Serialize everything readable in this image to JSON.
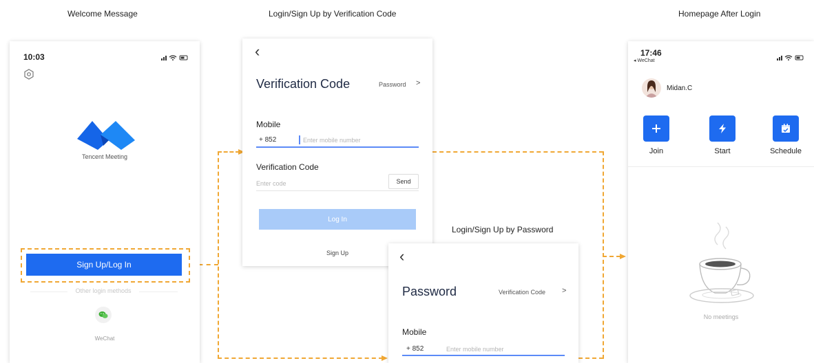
{
  "captions": {
    "welcome": "Welcome Message",
    "verify": "Login/Sign Up by Verification Code",
    "password": "Login/Sign Up by Password",
    "home": "Homepage After Login"
  },
  "welcome": {
    "time": "10:03",
    "app_name": "Tencent Meeting",
    "signup_button": "Sign Up/Log In",
    "other_methods": "Other login methods",
    "wechat_label": "WeChat"
  },
  "verify": {
    "back": "‹",
    "title": "Verification Code",
    "switch_link": "Password",
    "switch_chevron": ">",
    "mobile_label": "Mobile",
    "country_code": "+ 852",
    "mobile_placeholder": "Enter mobile number",
    "code_label": "Verification Code",
    "code_placeholder": "Enter code",
    "send_button": "Send",
    "login_button": "Log In",
    "signup_link": "Sign Up"
  },
  "password": {
    "back": "‹",
    "title": "Password",
    "switch_link": "Verification Code",
    "switch_chevron": ">",
    "mobile_label": "Mobile",
    "country_code": "+ 852",
    "mobile_placeholder": "Enter mobile number"
  },
  "home": {
    "time": "17:46",
    "back_app": "◂ WeChat",
    "user_name": "Midan.C",
    "actions": [
      {
        "label": "Join",
        "icon": "plus-icon"
      },
      {
        "label": "Start",
        "icon": "lightning-icon"
      },
      {
        "label": "Schedule",
        "icon": "calendar-icon"
      }
    ],
    "empty_text": "No meetings"
  },
  "colors": {
    "accent": "#1e6bf0",
    "flow": "#f0a733",
    "login_disabled": "#a9cbf9"
  }
}
